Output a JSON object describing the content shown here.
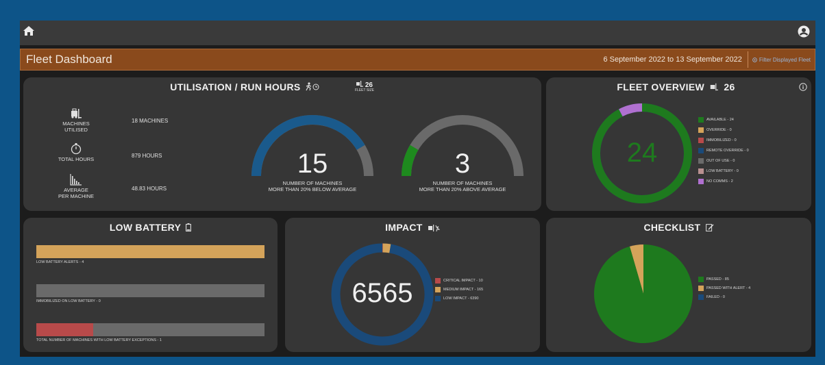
{
  "header": {
    "title": "Fleet Dashboard",
    "date_range": "6 September 2022 to 13 September 2022",
    "filter_label": "Filter Displayed Fleet"
  },
  "utilisation": {
    "title": "UTILISATION / RUN HOURS",
    "fleet_size_value": "26",
    "fleet_size_label": "FLEET SIZE",
    "stats": [
      {
        "label_line1": "MACHINES",
        "label_line2": "UTILISED",
        "value": "18 MACHINES"
      },
      {
        "label_line1": "TOTAL HOURS",
        "label_line2": "",
        "value": "879 HOURS"
      },
      {
        "label_line1": "AVERAGE",
        "label_line2": "PER MACHINE",
        "value": "48.83 HOURS"
      }
    ],
    "gauges": [
      {
        "value": "15",
        "caption_line1": "NUMBER OF MACHINES",
        "caption_line2": "MORE THAN 20% BELOW AVERAGE",
        "fraction": 0.83,
        "color": "#1a5a8c"
      },
      {
        "value": "3",
        "caption_line1": "NUMBER OF MACHINES",
        "caption_line2": "MORE THAN 20% ABOVE AVERAGE",
        "fraction": 0.17,
        "color": "#1e8a1e"
      }
    ]
  },
  "overview": {
    "title": "FLEET OVERVIEW",
    "count": "26",
    "center_value": "24",
    "legend": [
      {
        "label": "AVAILABLE - 24",
        "color": "#1e7a1e"
      },
      {
        "label": "OVERRIDE - 0",
        "color": "#d4a35a"
      },
      {
        "label": "IMMOBILIZED - 0",
        "color": "#b84a4a"
      },
      {
        "label": "REMOTE OVERRIDE - 0",
        "color": "#1a4a7a"
      },
      {
        "label": "OUT OF USE - 0",
        "color": "#6a6a6a"
      },
      {
        "label": "LOW BATTERY - 0",
        "color": "#b89090"
      },
      {
        "label": "NO COMMS - 2",
        "color": "#b070d0"
      }
    ],
    "segments": [
      {
        "value": 24,
        "color": "#1e7a1e"
      },
      {
        "value": 2,
        "color": "#b070d0"
      }
    ]
  },
  "low_battery": {
    "title": "LOW BATTERY",
    "bars": [
      {
        "label": "LOW BATTERY ALERTS - 4",
        "fill": 1.0,
        "color": "#d4a35a"
      },
      {
        "label": "IMMOBILIZED ON LOW BATTERY - 0",
        "fill": 0.0,
        "color": "#b84a4a"
      },
      {
        "label": "TOTAL NUMBER OF MACHINES WITH LOW BATTERY EXCEPTIONS - 1",
        "fill": 0.25,
        "color": "#b84a4a"
      }
    ]
  },
  "impact": {
    "title": "IMPACT",
    "center_value": "6565",
    "legend": [
      {
        "label": "CRITICAL IMPACT - 10",
        "color": "#b84a4a"
      },
      {
        "label": "MEDIUM IMPACT - 165",
        "color": "#d4a35a"
      },
      {
        "label": "LOW IMPACT - 6390",
        "color": "#1a4a7a"
      }
    ],
    "segments": [
      {
        "value": 10,
        "color": "#b84a4a"
      },
      {
        "value": 165,
        "color": "#d4a35a"
      },
      {
        "value": 6390,
        "color": "#1a4a7a"
      }
    ]
  },
  "checklist": {
    "title": "CHECKLIST",
    "legend": [
      {
        "label": "PASSED - 85",
        "color": "#1e7a1e"
      },
      {
        "label": "PASSED WITH ALERT - 4",
        "color": "#d4a35a"
      },
      {
        "label": "FAILED - 0",
        "color": "#1a4a7a"
      }
    ],
    "segments": [
      {
        "value": 85,
        "color": "#1e7a1e"
      },
      {
        "value": 4,
        "color": "#d4a35a"
      },
      {
        "value": 0,
        "color": "#1a4a7a"
      }
    ]
  }
}
